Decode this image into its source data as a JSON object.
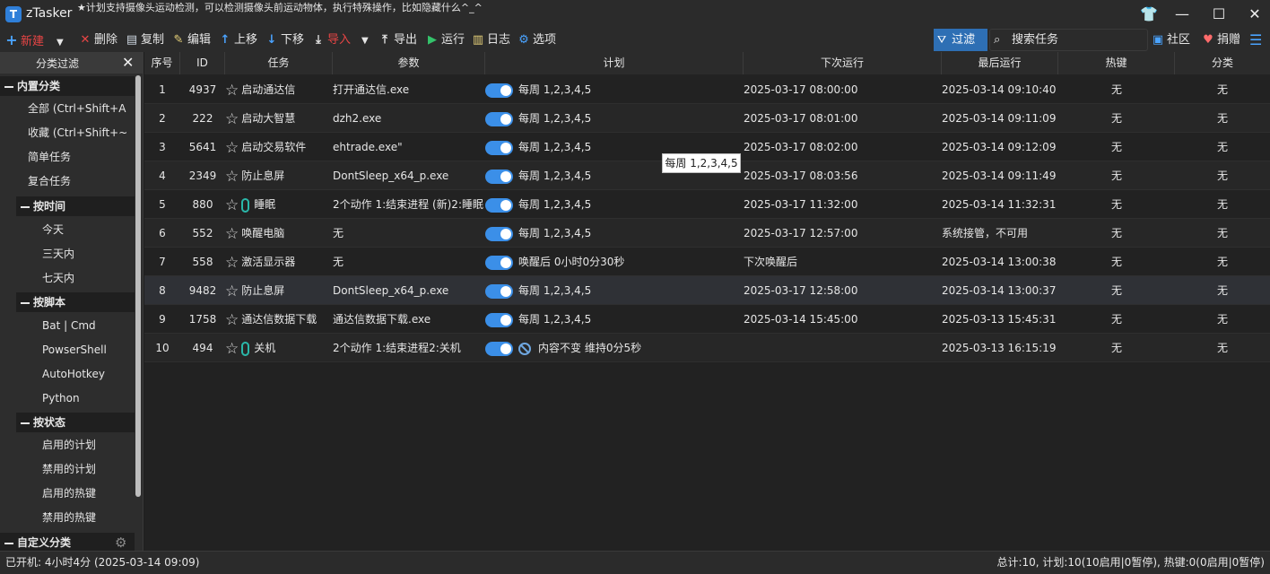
{
  "app": {
    "logo_text": "T",
    "title": "zTasker",
    "slogan": "★计划支持摄像头运动检测，可以检测摄像头前运动物体，执行特殊操作，比如隐藏什么^_^"
  },
  "window_controls": {
    "skin": "👕",
    "minimize": "—",
    "maximize": "☐",
    "close": "✕"
  },
  "toolbar": {
    "new": "新建",
    "delete": "删除",
    "copy": "复制",
    "edit": "编辑",
    "up": "上移",
    "down": "下移",
    "import": "导入",
    "export": "导出",
    "run": "运行",
    "log": "日志",
    "options": "选项",
    "filter": "过滤",
    "search_placeholder": "搜索任务",
    "community": "社区",
    "donate": "捐赠"
  },
  "sidebar": {
    "title": "分类过滤",
    "groups": {
      "builtin": "内置分类",
      "by_time": "按时间",
      "by_script": "按脚本",
      "by_status": "按状态",
      "custom": "自定义分类"
    },
    "builtin_items": [
      "全部 (Ctrl+Shift+A",
      "收藏 (Ctrl+Shift+~",
      "简单任务",
      "复合任务"
    ],
    "time_items": [
      "今天",
      "三天内",
      "七天内"
    ],
    "script_items": [
      "Bat | Cmd",
      "PowserShell",
      "AutoHotkey",
      "Python"
    ],
    "status_items": [
      "启用的计划",
      "禁用的计划",
      "启用的热键",
      "禁用的热键"
    ]
  },
  "table": {
    "headers": [
      "序号",
      "ID",
      "任务",
      "参数",
      "计划",
      "下次运行",
      "最后运行",
      "热键",
      "分类"
    ],
    "rows": [
      {
        "no": "1",
        "id": "4937",
        "task": "启动通达信",
        "param": "打开通达信.exe",
        "plan": "每周 1,2,3,4,5",
        "next": "2025-03-17 08:00:00",
        "last": "2025-03-14 09:10:40",
        "hotkey": "无",
        "cat": "无",
        "link": false,
        "plan_icon": "toggle"
      },
      {
        "no": "2",
        "id": "222",
        "task": "启动大智慧",
        "param": "dzh2.exe",
        "plan": "每周 1,2,3,4,5",
        "next": "2025-03-17 08:01:00",
        "last": "2025-03-14 09:11:09",
        "hotkey": "无",
        "cat": "无",
        "link": false,
        "plan_icon": "toggle"
      },
      {
        "no": "3",
        "id": "5641",
        "task": "启动交易软件",
        "param": "ehtrade.exe\"",
        "plan": "每周 1,2,3,4,5",
        "next": "2025-03-17 08:02:00",
        "last": "2025-03-14 09:12:09",
        "hotkey": "无",
        "cat": "无",
        "link": false,
        "plan_icon": "toggle"
      },
      {
        "no": "4",
        "id": "2349",
        "task": "防止息屏",
        "param": "DontSleep_x64_p.exe",
        "plan": "每周 1,2,3,4,5",
        "next": "2025-03-17 08:03:56",
        "last": "2025-03-14 09:11:49",
        "hotkey": "无",
        "cat": "无",
        "link": false,
        "plan_icon": "toggle"
      },
      {
        "no": "5",
        "id": "880",
        "task": "睡眠",
        "param": "2个动作 1:结束进程 (新)2:睡眠",
        "plan": "每周 1,2,3,4,5",
        "next": "2025-03-17 11:32:00",
        "last": "2025-03-14 11:32:31",
        "hotkey": "无",
        "cat": "无",
        "link": true,
        "plan_icon": "toggle"
      },
      {
        "no": "6",
        "id": "552",
        "task": "唤醒电脑",
        "param": "无",
        "plan": "每周 1,2,3,4,5",
        "next": "2025-03-17 12:57:00",
        "last": "系统接管，不可用",
        "hotkey": "无",
        "cat": "无",
        "link": false,
        "plan_icon": "toggle"
      },
      {
        "no": "7",
        "id": "558",
        "task": "激活显示器",
        "param": "无",
        "plan": "唤醒后 0小时0分30秒",
        "next": "下次唤醒后",
        "last": "2025-03-14 13:00:38",
        "hotkey": "无",
        "cat": "无",
        "link": false,
        "plan_icon": "toggle"
      },
      {
        "no": "8",
        "id": "9482",
        "task": "防止息屏",
        "param": "DontSleep_x64_p.exe",
        "plan": "每周 1,2,3,4,5",
        "next": "2025-03-17 12:58:00",
        "last": "2025-03-14 13:00:37",
        "hotkey": "无",
        "cat": "无",
        "link": false,
        "plan_icon": "toggle"
      },
      {
        "no": "9",
        "id": "1758",
        "task": "通达信数据下载",
        "param": "通达信数据下载.exe",
        "plan": "每周 1,2,3,4,5",
        "next": "2025-03-14 15:45:00",
        "last": "2025-03-13 15:45:31",
        "hotkey": "无",
        "cat": "无",
        "link": false,
        "plan_icon": "toggle"
      },
      {
        "no": "10",
        "id": "494",
        "task": "关机",
        "param": "2个动作 1:结束进程2:关机",
        "plan": "内容不变 维持0分5秒",
        "next": "",
        "last": "2025-03-13 16:15:19",
        "hotkey": "无",
        "cat": "无",
        "link": true,
        "plan_icon": "toggle-noentry"
      }
    ]
  },
  "tooltip": "每周 1,2,3,4,5",
  "status": {
    "left": "已开机: 4小时4分 (2025-03-14 09:09)",
    "right": "总计:10, 计划:10(10启用|0暂停), 热键:0(0启用|0暂停)"
  }
}
